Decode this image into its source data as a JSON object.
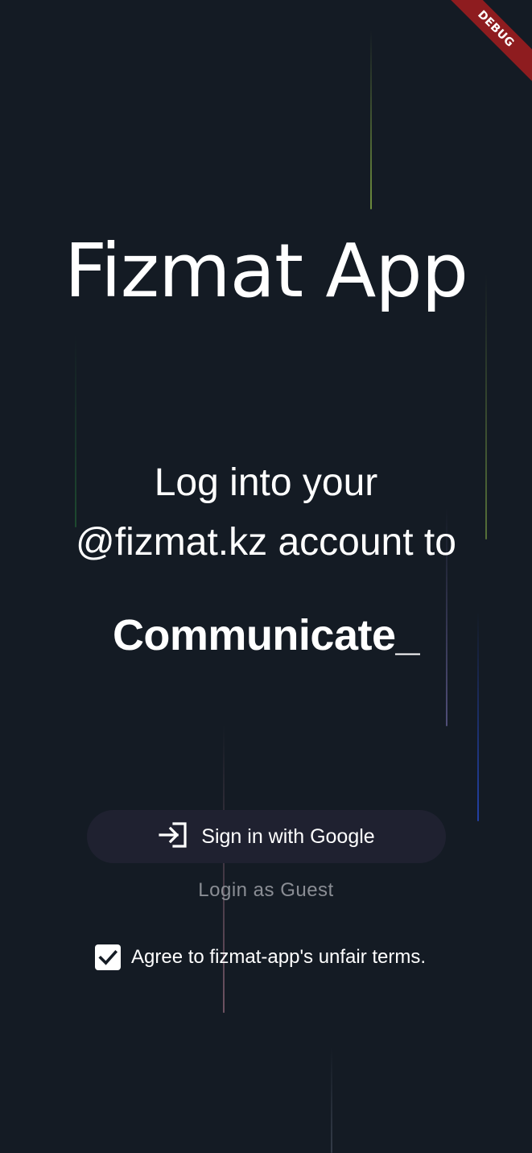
{
  "app": {
    "title": "Fizmat App"
  },
  "login": {
    "subtitle_line1": "Log into your",
    "subtitle_line2": "@fizmat.kz account to",
    "typed_text": "Communicate_",
    "google_button_label": "Sign in with Google",
    "google_button_icon": "login-arrow-icon",
    "guest_label": "Login as Guest",
    "terms_label": "Agree to fizmat-app's unfair terms.",
    "terms_checked": true
  },
  "debug_banner": {
    "label": "DEBUG",
    "color": "#8e1c1f"
  },
  "colors": {
    "background": "#141b24",
    "button": "#1f2130",
    "muted_text": "#8a8d94"
  }
}
